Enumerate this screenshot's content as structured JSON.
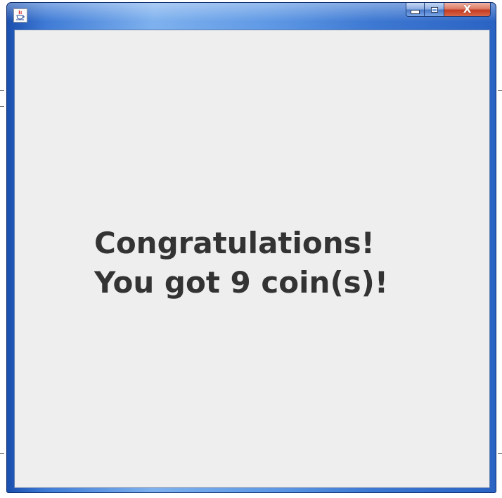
{
  "window": {
    "app_icon": "java-cup-icon",
    "controls": {
      "minimize_icon": "minimize-icon",
      "maximize_icon": "maximize-icon",
      "close_icon": "close-icon",
      "close_glyph": "X"
    }
  },
  "message": {
    "line1": "Congratulations!",
    "line2": "You got 9 coin(s)!"
  },
  "colors": {
    "content_background": "#eeeeee",
    "text": "#333333",
    "frame_accent": "#2b63c3",
    "close_button": "#c53c21"
  }
}
